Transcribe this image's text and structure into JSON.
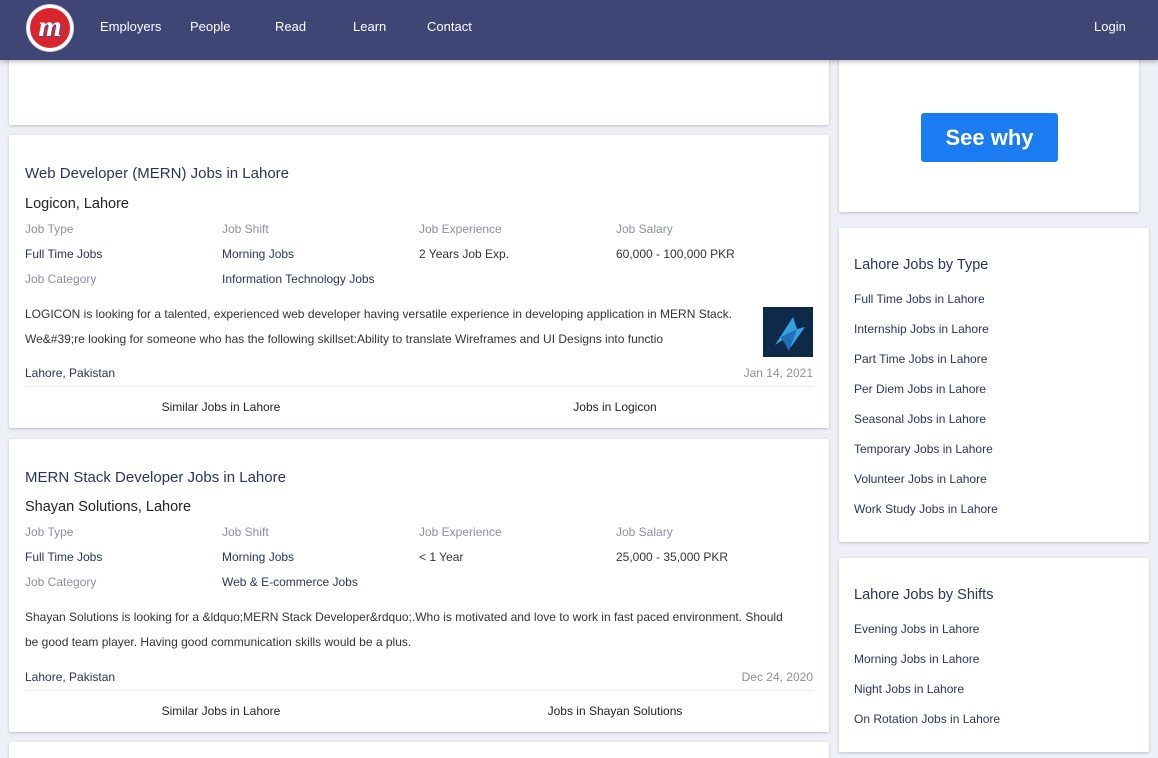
{
  "header": {
    "logo_letter": "m",
    "nav": [
      "Employers",
      "People",
      "Read",
      "Learn",
      "Contact"
    ],
    "login": "Login"
  },
  "jobs": [
    {
      "title": "Web Developer (MERN) Jobs in Lahore",
      "company": "Logicon, Lahore",
      "labels": [
        "Job Type",
        "Job Shift",
        "Job Experience",
        "Job Salary",
        "Job Category"
      ],
      "job_type": "Full Time Jobs",
      "job_shift": "Morning Jobs",
      "job_experience": "2 Years Job Exp.",
      "job_salary": "60,000 - 100,000 PKR",
      "job_category": "Information Technology Jobs",
      "description": "LOGICON is looking for a talented, experienced web developer having versatile experience in developing application in MERN Stack. We&#39;re looking for someone who has the following skillset:Ability to translate Wireframes and UI Designs into functio",
      "location": "Lahore, Pakistan",
      "date": "Jan 14, 2021",
      "similar_link": "Similar Jobs in Lahore",
      "company_link": "Jobs in Logicon"
    },
    {
      "title": "MERN Stack Developer Jobs in Lahore",
      "company": "Shayan Solutions, Lahore",
      "labels": [
        "Job Type",
        "Job Shift",
        "Job Experience",
        "Job Salary",
        "Job Category"
      ],
      "job_type": "Full Time Jobs",
      "job_shift": "Morning Jobs",
      "job_experience": "< 1 Year",
      "job_salary": "25,000 - 35,000 PKR",
      "job_category": "Web & E-commerce Jobs",
      "description": "Shayan Solutions is looking for a &ldquo;MERN Stack Developer&rdquo;.Who is motivated and love to work in fast paced environment. Should be good team player. Having good communication skills would be a plus.",
      "location": "Lahore, Pakistan",
      "date": "Dec 24, 2020",
      "similar_link": "Similar Jobs in Lahore",
      "company_link": "Jobs in Shayan Solutions"
    }
  ],
  "sidebar": {
    "ad_button": "See why",
    "by_type": {
      "title": "Lahore Jobs by Type",
      "links": [
        "Full Time Jobs in Lahore",
        "Internship Jobs in Lahore",
        "Part Time Jobs in Lahore",
        "Per Diem Jobs in Lahore",
        "Seasonal Jobs in Lahore",
        "Temporary Jobs in Lahore",
        "Volunteer Jobs in Lahore",
        "Work Study Jobs in Lahore"
      ]
    },
    "by_shift": {
      "title": "Lahore Jobs by Shifts",
      "links": [
        "Evening Jobs in Lahore",
        "Morning Jobs in Lahore",
        "Night Jobs in Lahore",
        "On Rotation Jobs in Lahore"
      ]
    }
  },
  "colors": {
    "header_bg": "#3f4676",
    "accent_button": "#1a7cf0",
    "link": "#2a3360"
  }
}
